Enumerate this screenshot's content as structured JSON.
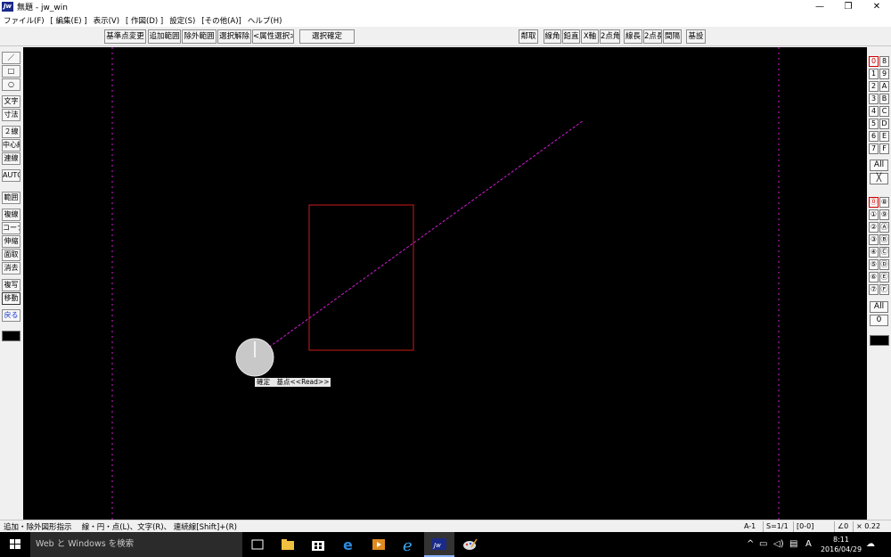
{
  "window": {
    "app_logo": "Jw",
    "title": "無題 - jw_win",
    "controls": {
      "minimize": "—",
      "maximize": "❐",
      "close": "✕"
    }
  },
  "menu": [
    "ファイル(F)",
    "[ 編集(E) ]",
    "表示(V)",
    "[ 作図(D) ]",
    "設定(S)",
    "[その他(A)]",
    "ヘルプ(H)"
  ],
  "toolbar": {
    "left": [
      "基準点変更",
      "追加範囲",
      "除外範囲",
      "選択解除",
      "<属性選択>",
      "選択確定"
    ],
    "right": [
      "鄰取",
      "線角",
      "鉛直",
      "X軸",
      "2点角",
      "線長",
      "2点長",
      "間隔",
      "基設"
    ]
  },
  "left_tools": [
    "／",
    "□",
    "○",
    "文字",
    "寸法",
    "２線",
    "中心線",
    "連線",
    "AUTO",
    "範囲",
    "複線",
    "コーナー",
    "伸縮",
    "面取",
    "消去",
    "複写",
    "移動",
    "戻る"
  ],
  "right_panel": {
    "groups_top": [
      [
        "0",
        "8"
      ],
      [
        "1",
        "9"
      ],
      [
        "2",
        "A"
      ],
      [
        "3",
        "B"
      ],
      [
        "4",
        "C"
      ],
      [
        "5",
        "D"
      ],
      [
        "6",
        "E"
      ],
      [
        "7",
        "F"
      ]
    ],
    "all_top": "All",
    "x_top": "╳",
    "groups_bottom": [
      [
        "⓪",
        "⑧"
      ],
      [
        "①",
        "⑨"
      ],
      [
        "②",
        "Ⓐ"
      ],
      [
        "③",
        "Ⓑ"
      ],
      [
        "④",
        "Ⓒ"
      ],
      [
        "⑤",
        "Ⓓ"
      ],
      [
        "⑥",
        "Ⓔ"
      ],
      [
        "⑦",
        "Ⓕ"
      ]
    ],
    "all_bottom": "All",
    "zero_bottom": "0"
  },
  "canvas": {
    "cursor_label": "確定　基点<<Read>>",
    "colors": {
      "background": "#000000",
      "rectangle": "#cc1a1a",
      "line": "#d51ad5",
      "guide": "#d51ad5"
    }
  },
  "status": {
    "message": "追加・除外図形指示　 線・円・点(L)、文字(R)、 連続線[Shift]+(R)",
    "paper": "A-1",
    "scale": "S=1/1",
    "layer": "[0-0]",
    "angle": "∠0",
    "zoom": "× 0.22"
  },
  "taskbar": {
    "search_placeholder": "Web と Windows を検索",
    "tray_ime": "A",
    "clock_time": "8:11",
    "clock_date": "2016/04/29"
  }
}
